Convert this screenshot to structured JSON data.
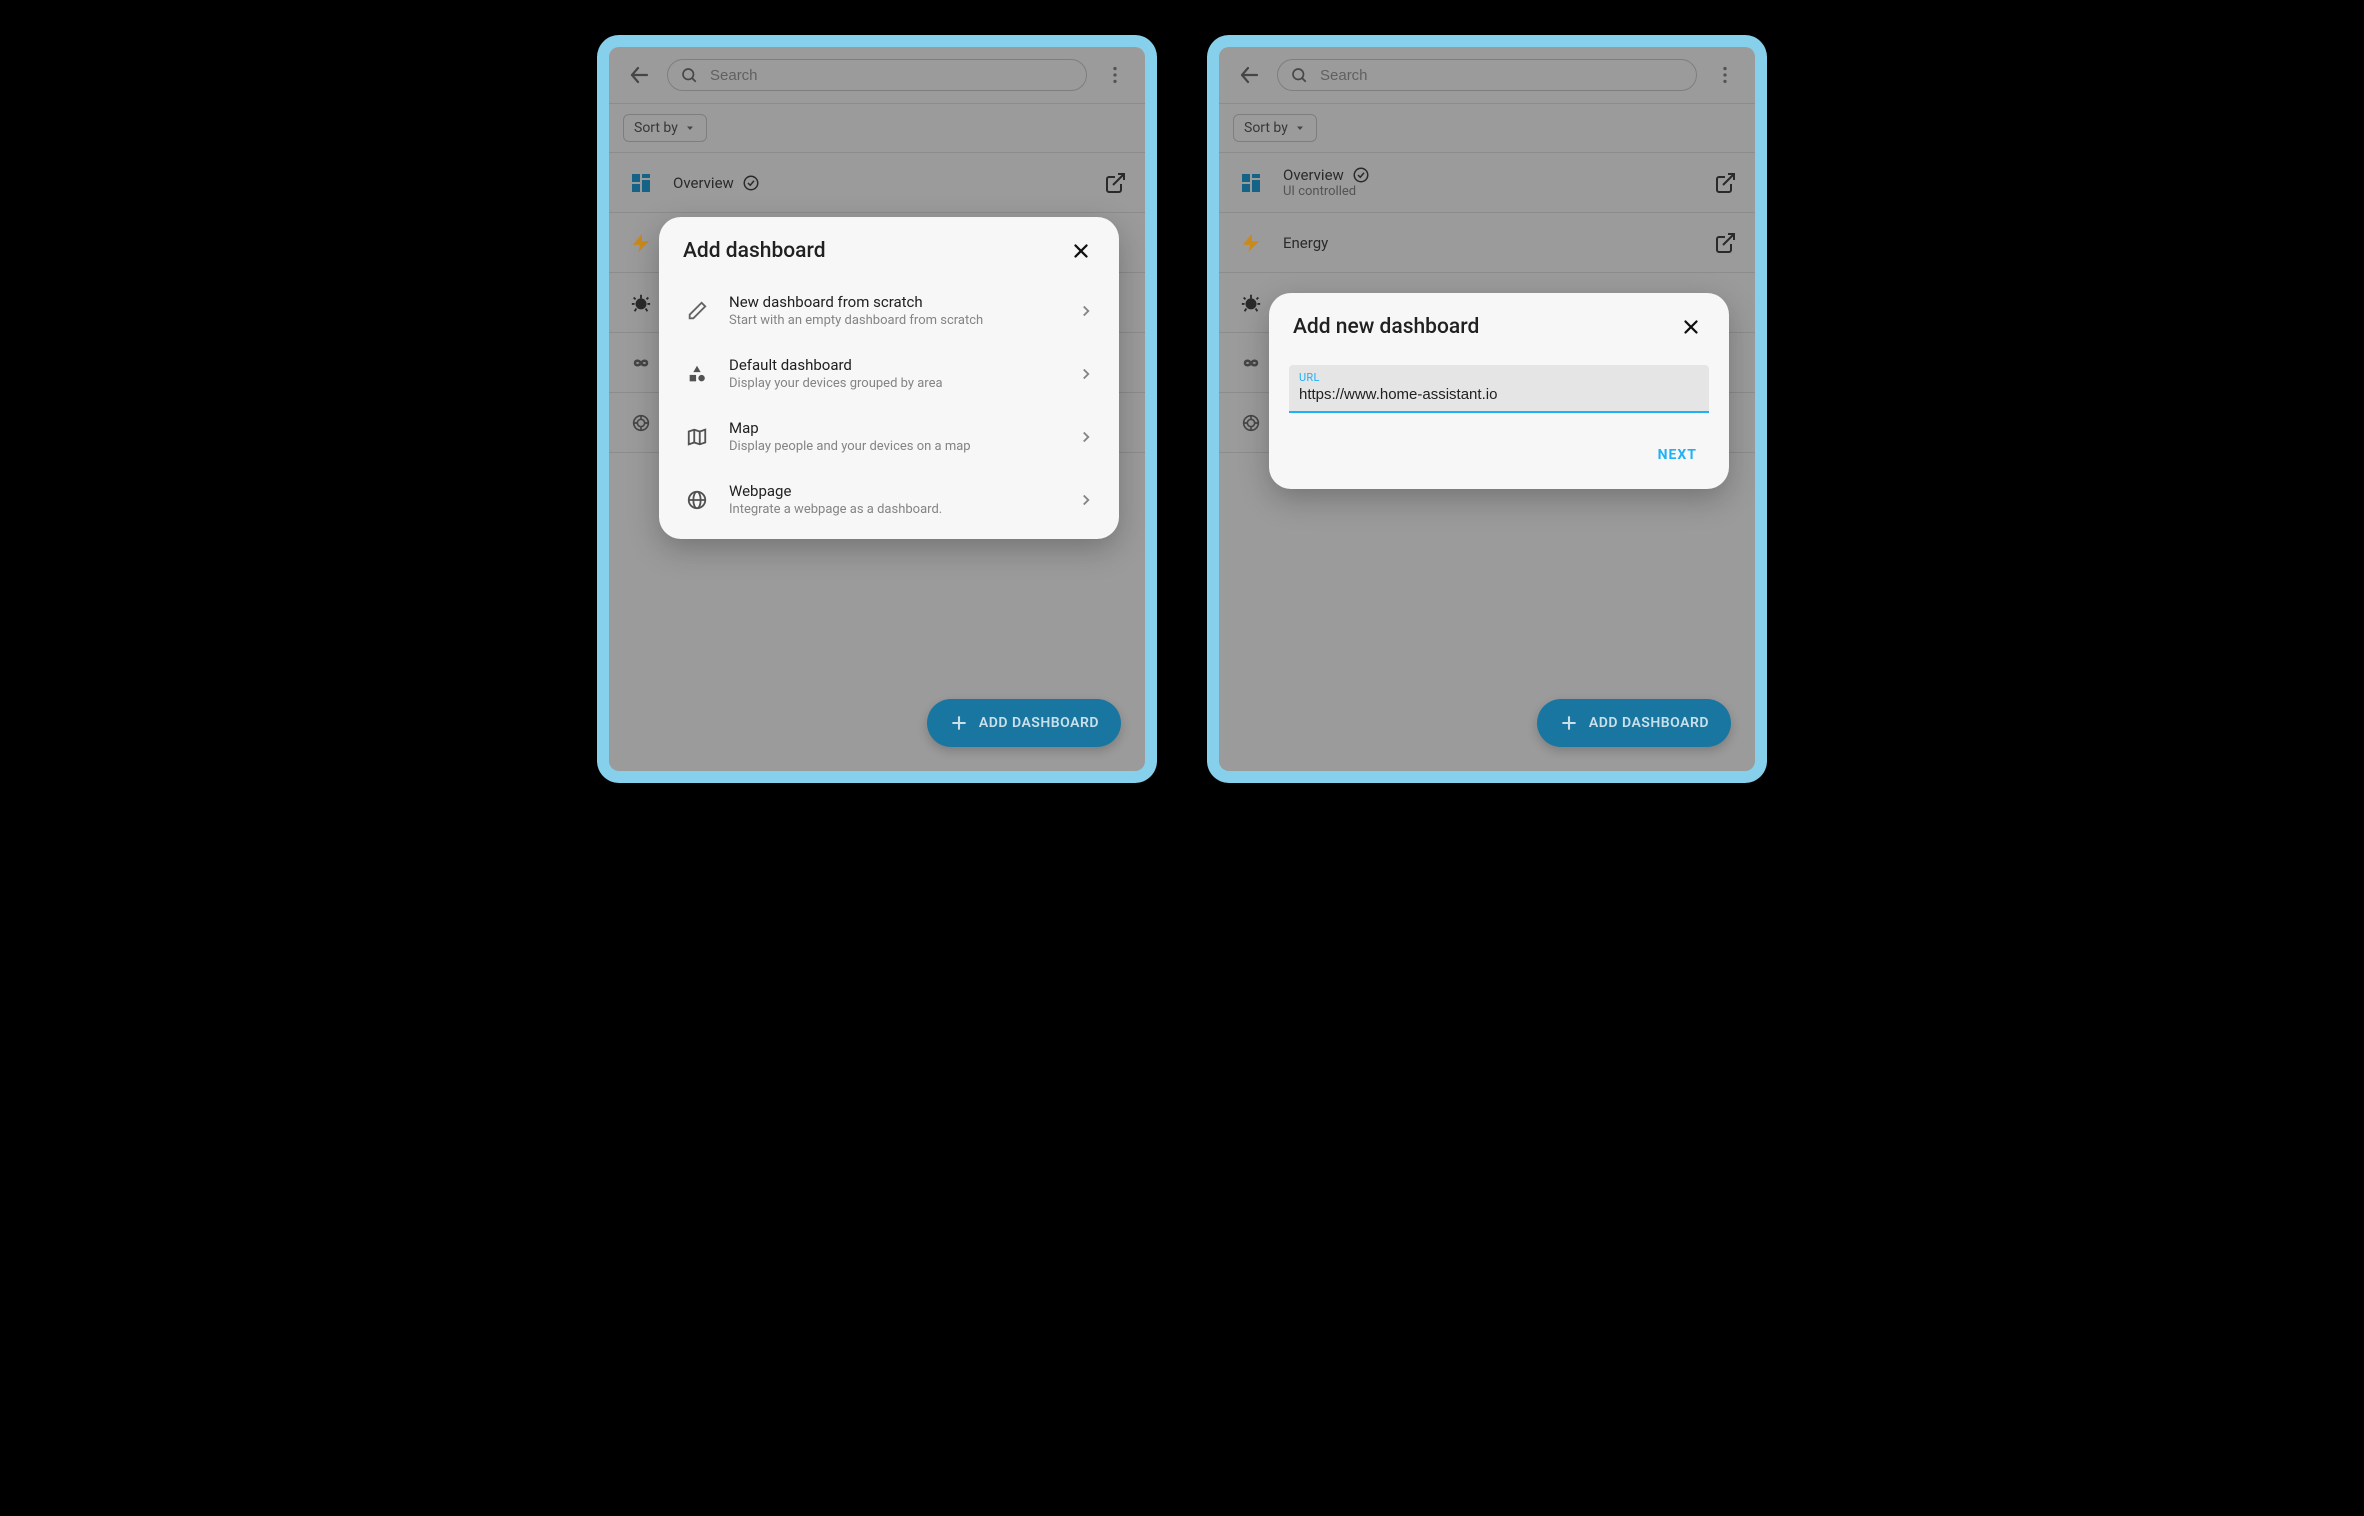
{
  "header": {
    "search_placeholder": "Search"
  },
  "sort": {
    "label": "Sort by"
  },
  "dashboards": [
    {
      "title": "Overview",
      "subtitle": "UI controlled",
      "icon": "grid",
      "checked": true
    },
    {
      "title": "Energy",
      "subtitle": "",
      "icon": "bolt",
      "checked": false
    }
  ],
  "hidden_dashboards": [
    {
      "icon": "bug"
    },
    {
      "icon": "infinity"
    },
    {
      "icon": "brain"
    }
  ],
  "fab": {
    "label": "ADD DASHBOARD"
  },
  "dialog1": {
    "title": "Add dashboard",
    "options": [
      {
        "title": "New dashboard from scratch",
        "desc": "Start with an empty dashboard from scratch",
        "icon": "pencil"
      },
      {
        "title": "Default dashboard",
        "desc": "Display your devices grouped by area",
        "icon": "shapes"
      },
      {
        "title": "Map",
        "desc": "Display people and your devices on a map",
        "icon": "map"
      },
      {
        "title": "Webpage",
        "desc": "Integrate a webpage as a dashboard.",
        "icon": "globe"
      }
    ]
  },
  "dialog2": {
    "title": "Add new dashboard",
    "field_label": "URL",
    "field_value": "https://www.home-assistant.io",
    "next_label": "NEXT"
  }
}
